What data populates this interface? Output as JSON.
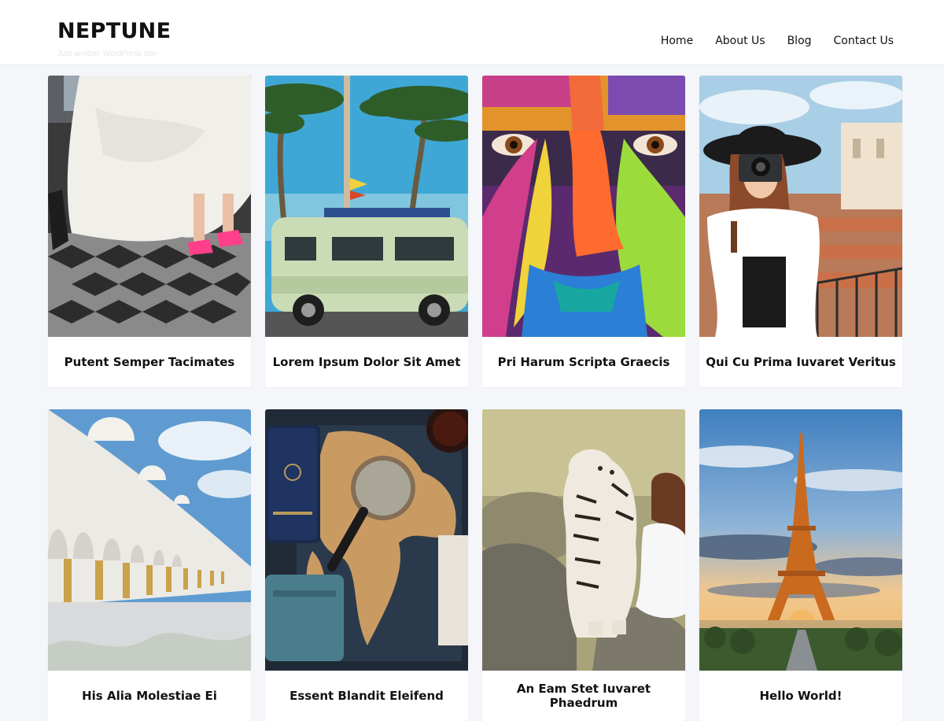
{
  "site": {
    "title": "NEPTUNE",
    "tagline": "Just another WordPress site"
  },
  "nav": {
    "items": [
      "Home",
      "About Us",
      "Blog",
      "Contact Us"
    ]
  },
  "posts": [
    {
      "title": "Putent Semper Tacimates",
      "image": "bride-pink-sneakers-photo"
    },
    {
      "title": "Lorem Ipsum Dolor Sit Amet",
      "image": "camper-van-palm-trees-photo"
    },
    {
      "title": "Pri Harum Scripta Graecis",
      "image": "painted-face-photo"
    },
    {
      "title": "Qui Cu Prima Iuvaret Veritus",
      "image": "woman-with-camera-photo"
    },
    {
      "title": "His Alia Molestiae Ei",
      "image": "white-mosque-arcade-photo"
    },
    {
      "title": "Essent Blandit Eleifend",
      "image": "travel-map-magnifier-photo"
    },
    {
      "title": "An Eam Stet Iuvaret Phaedrum",
      "image": "white-tiger-woman-photo"
    },
    {
      "title": "Hello World!",
      "image": "eiffel-tower-sunset-photo"
    }
  ]
}
